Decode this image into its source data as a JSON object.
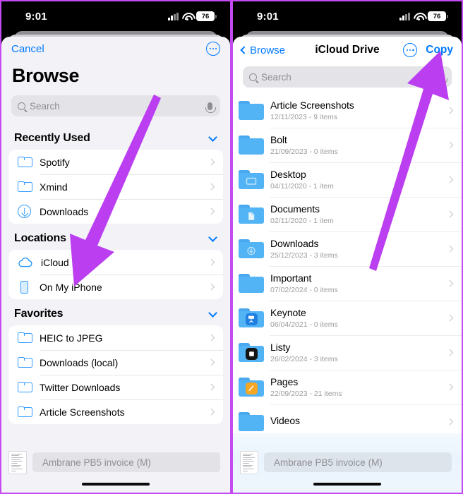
{
  "status_bar": {
    "time": "9:01",
    "battery_level": "76",
    "signal_icon": "cellular-signal-icon",
    "wifi_icon": "wifi-icon",
    "battery_icon": "battery-icon"
  },
  "colors": {
    "accent_blue": "#007aff",
    "folder_blue": "#53b4f5",
    "annotation_purple": "#bb3ef0",
    "sheet_background": "#f2f2f7"
  },
  "left_panel": {
    "nav": {
      "cancel_label": "Cancel",
      "more_icon": "ellipsis-circle-icon"
    },
    "title": "Browse",
    "search": {
      "placeholder": "Search",
      "search_icon": "search-icon",
      "mic_icon": "microphone-icon"
    },
    "sections": [
      {
        "title": "Recently Used",
        "collapse_icon": "chevron-down-icon",
        "items": [
          {
            "label": "Spotify",
            "icon": "folder-outline-icon"
          },
          {
            "label": "Xmind",
            "icon": "folder-outline-icon"
          },
          {
            "label": "Downloads",
            "icon": "download-circle-icon"
          }
        ]
      },
      {
        "title": "Locations",
        "collapse_icon": "chevron-down-icon",
        "items": [
          {
            "label": "iCloud Drive",
            "icon": "cloud-icon"
          },
          {
            "label": "On My iPhone",
            "icon": "iphone-icon"
          }
        ]
      },
      {
        "title": "Favorites",
        "collapse_icon": "chevron-down-icon",
        "items": [
          {
            "label": "HEIC to JPEG",
            "icon": "folder-outline-icon"
          },
          {
            "label": "Downloads (local)",
            "icon": "folder-outline-icon"
          },
          {
            "label": "Twitter Downloads",
            "icon": "folder-outline-icon"
          },
          {
            "label": "Article Screenshots",
            "icon": "folder-outline-icon"
          }
        ]
      }
    ],
    "drag_item": {
      "label": "Ambrane PB5 invoice (M)",
      "thumbnail_icon": "document-thumbnail-icon"
    }
  },
  "right_panel": {
    "nav": {
      "back_label": "Browse",
      "back_icon": "chevron-left-icon",
      "title": "iCloud Drive",
      "more_icon": "ellipsis-circle-icon",
      "copy_label": "Copy"
    },
    "search": {
      "placeholder": "Search",
      "search_icon": "search-icon",
      "mic_icon": "microphone-icon"
    },
    "files": [
      {
        "name": "Article Screenshots",
        "meta": "12/11/2023 - 9 items",
        "icon": "folder-icon"
      },
      {
        "name": "Bolt",
        "meta": "21/09/2023 - 0 items",
        "icon": "folder-icon"
      },
      {
        "name": "Desktop",
        "meta": "04/11/2020 - 1 item",
        "icon": "folder-desktop-icon"
      },
      {
        "name": "Documents",
        "meta": "02/11/2020 - 1 item",
        "icon": "folder-documents-icon"
      },
      {
        "name": "Downloads",
        "meta": "25/12/2023 - 3 items",
        "icon": "folder-downloads-icon"
      },
      {
        "name": "Important",
        "meta": "07/02/2024 - 0 items",
        "icon": "folder-icon"
      },
      {
        "name": "Keynote",
        "meta": "06/04/2021 - 0 items",
        "icon": "folder-keynote-icon"
      },
      {
        "name": "Listy",
        "meta": "26/02/2024 - 3 items",
        "icon": "folder-listy-icon"
      },
      {
        "name": "Pages",
        "meta": "22/09/2023 - 21 items",
        "icon": "folder-pages-icon"
      },
      {
        "name": "Videos",
        "meta": "",
        "icon": "folder-icon"
      }
    ],
    "drag_item": {
      "label": "Ambrane PB5 invoice (M)",
      "thumbnail_icon": "document-thumbnail-icon"
    }
  },
  "annotations": [
    {
      "name": "arrow-to-icloud-drive",
      "panel": "left",
      "color": "#bb3ef0"
    },
    {
      "name": "arrow-to-copy-button",
      "panel": "right",
      "color": "#bb3ef0"
    }
  ]
}
